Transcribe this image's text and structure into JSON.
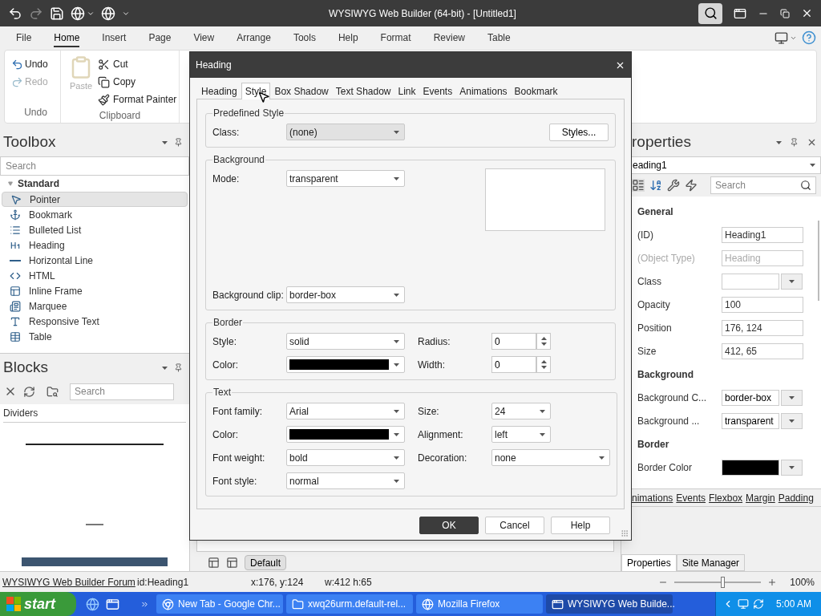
{
  "title_bar": {
    "title": "WYSIWYG Web Builder (64-bit) - [Untitled1]"
  },
  "menu": [
    {
      "label": "File",
      "selected": false
    },
    {
      "label": "Home",
      "selected": true
    },
    {
      "label": "Insert",
      "selected": false
    },
    {
      "label": "Page",
      "selected": false
    },
    {
      "label": "View",
      "selected": false
    },
    {
      "label": "Arrange",
      "selected": false
    },
    {
      "label": "Tools",
      "selected": false
    },
    {
      "label": "Help",
      "selected": false
    },
    {
      "label": "Format",
      "selected": false
    },
    {
      "label": "Review",
      "selected": false
    },
    {
      "label": "Table",
      "selected": false
    }
  ],
  "ribbon": {
    "undo_group": {
      "label": "Undo",
      "items": [
        {
          "label": "Undo",
          "kind": "undo",
          "disabled": false
        },
        {
          "label": "Redo",
          "kind": "redo",
          "disabled": true
        }
      ]
    },
    "clipboard_group": {
      "label": "Clipboard",
      "paste": {
        "label": "Paste",
        "disabled": true
      },
      "items": [
        {
          "label": "Cut",
          "kind": "cut"
        },
        {
          "label": "Copy",
          "kind": "copy"
        },
        {
          "label": "Format Painter",
          "kind": "painter"
        }
      ]
    }
  },
  "toolbox": {
    "title": "Toolbox",
    "search_placeholder": "Search",
    "category": {
      "label": "Standard",
      "expanded": true
    },
    "items": [
      {
        "label": "Pointer",
        "kind": "pointer",
        "selected": true
      },
      {
        "label": "Bookmark",
        "kind": "bookmark",
        "selected": false
      },
      {
        "label": "Bulleted List",
        "kind": "list",
        "selected": false
      },
      {
        "label": "Heading",
        "kind": "heading",
        "selected": false
      },
      {
        "label": "Horizontal Line",
        "kind": "line",
        "selected": false
      },
      {
        "label": "HTML",
        "kind": "html",
        "selected": false
      },
      {
        "label": "Inline Frame",
        "kind": "frame",
        "selected": false
      },
      {
        "label": "Marquee",
        "kind": "marquee",
        "selected": false
      },
      {
        "label": "Responsive Text",
        "kind": "text",
        "selected": false
      },
      {
        "label": "Table",
        "kind": "table",
        "selected": false
      }
    ]
  },
  "blocks": {
    "title": "Blocks",
    "search_placeholder": "Search",
    "category": "Dividers"
  },
  "canvas": {
    "page_tabs": [
      {
        "label": "Default",
        "selected": true
      }
    ]
  },
  "properties": {
    "title": "roperties",
    "object": "eading1",
    "search_placeholder": "Search",
    "sections": [
      {
        "title": "General",
        "rows": [
          {
            "label": "(ID)",
            "value": "Heading1",
            "kind": "text",
            "disabled": false
          },
          {
            "label": "(Object Type)",
            "value": "Heading",
            "kind": "text",
            "disabled": true
          },
          {
            "label": "Class",
            "kind": "dropdown",
            "disabled": false
          },
          {
            "label": "Opacity",
            "value": "100",
            "kind": "text",
            "disabled": false
          },
          {
            "label": "Position",
            "value": "176, 124",
            "kind": "text",
            "disabled": false
          },
          {
            "label": "Size",
            "value": "412, 65",
            "kind": "text",
            "disabled": false
          }
        ]
      },
      {
        "title": "Background",
        "rows": [
          {
            "label": "Background C...",
            "value": "border-box",
            "kind": "dropdown",
            "disabled": false
          },
          {
            "label": "Background ...",
            "value": "transparent",
            "kind": "dropdown",
            "disabled": false
          }
        ]
      },
      {
        "title": "Border",
        "rows": [
          {
            "label": "Border Color",
            "kind": "color",
            "color": "#000000",
            "disabled": false
          }
        ]
      }
    ],
    "links": [
      "nimations",
      "Events",
      "Flexbox",
      "Margin",
      "Padding"
    ],
    "tabs": [
      {
        "label": "Properties",
        "selected": true
      },
      {
        "label": "Site Manager",
        "selected": false
      }
    ]
  },
  "dialog": {
    "title": "Heading",
    "tabs": [
      {
        "label": "Heading",
        "selected": false
      },
      {
        "label": "Style",
        "selected": true
      },
      {
        "label": "Box Shadow",
        "selected": false
      },
      {
        "label": "Text Shadow",
        "selected": false
      },
      {
        "label": "Link",
        "selected": false
      },
      {
        "label": "Events",
        "selected": false
      },
      {
        "label": "Animations",
        "selected": false
      },
      {
        "label": "Bookmark",
        "selected": false
      }
    ],
    "groups": [
      {
        "title": "Predefined Style",
        "kind": "fields",
        "rows": [
          {
            "left": {
              "label": "Class:",
              "value": "(none)",
              "kind": "select",
              "disabled": true
            },
            "right": {
              "label": "Styles...",
              "kind": "button"
            }
          }
        ]
      },
      {
        "title": "Background",
        "kind": "preview",
        "rows": [
          {
            "left": {
              "label": "Mode:",
              "value": "transparent",
              "kind": "select",
              "disabled": false
            }
          },
          {
            "left": {
              "label": "Background clip:",
              "value": "border-box",
              "kind": "select",
              "disabled": false
            }
          }
        ]
      },
      {
        "title": "Border",
        "kind": "fields",
        "rows": [
          {
            "left": {
              "label": "Style:",
              "value": "solid",
              "kind": "select",
              "disabled": false
            },
            "right": {
              "label": "Radius:",
              "value": "0",
              "kind": "spin"
            }
          },
          {
            "left": {
              "label": "Color:",
              "kind": "color",
              "color": "#000000"
            },
            "right": {
              "label": "Width:",
              "value": "0",
              "kind": "spin"
            }
          }
        ]
      },
      {
        "title": "Text",
        "kind": "fields",
        "rows": [
          {
            "left": {
              "label": "Font family:",
              "value": "Arial",
              "kind": "select",
              "disabled": false
            },
            "right": {
              "label": "Size:",
              "value": "24",
              "kind": "short_select"
            }
          },
          {
            "left": {
              "label": "Color:",
              "kind": "color",
              "color": "#000000"
            },
            "right": {
              "label": "Alignment:",
              "value": "left",
              "kind": "short_select"
            }
          },
          {
            "left": {
              "label": "Font weight:",
              "value": "bold",
              "kind": "select",
              "disabled": false
            },
            "right": {
              "label": "Decoration:",
              "value": "none",
              "kind": "select",
              "disabled": false
            }
          },
          {
            "left": {
              "label": "Font style:",
              "value": "normal",
              "kind": "select",
              "disabled": false
            }
          }
        ]
      }
    ],
    "buttons": [
      {
        "label": "OK",
        "default": true
      },
      {
        "label": "Cancel",
        "default": false
      },
      {
        "label": "Help",
        "default": false
      }
    ]
  },
  "status_bar": {
    "link": "WYSIWYG Web Builder Forum",
    "id": "id:Heading1",
    "position": "x:176, y:124",
    "size": "w:412 h:65",
    "zoom": {
      "level": 0.55,
      "reading": "100%"
    }
  },
  "taskbar": {
    "start": "start",
    "tasks": [
      {
        "label": "New Tab - Google Chr...",
        "kind": "browser",
        "selected": false
      },
      {
        "label": "xwq26urm.default-rel...",
        "kind": "folder",
        "selected": false
      },
      {
        "label": "Mozilla Firefox",
        "kind": "ie",
        "selected": false
      },
      {
        "label": "WYSIWYG Web Builde...",
        "kind": "app",
        "selected": true
      }
    ],
    "clock": "5:00 AM"
  }
}
